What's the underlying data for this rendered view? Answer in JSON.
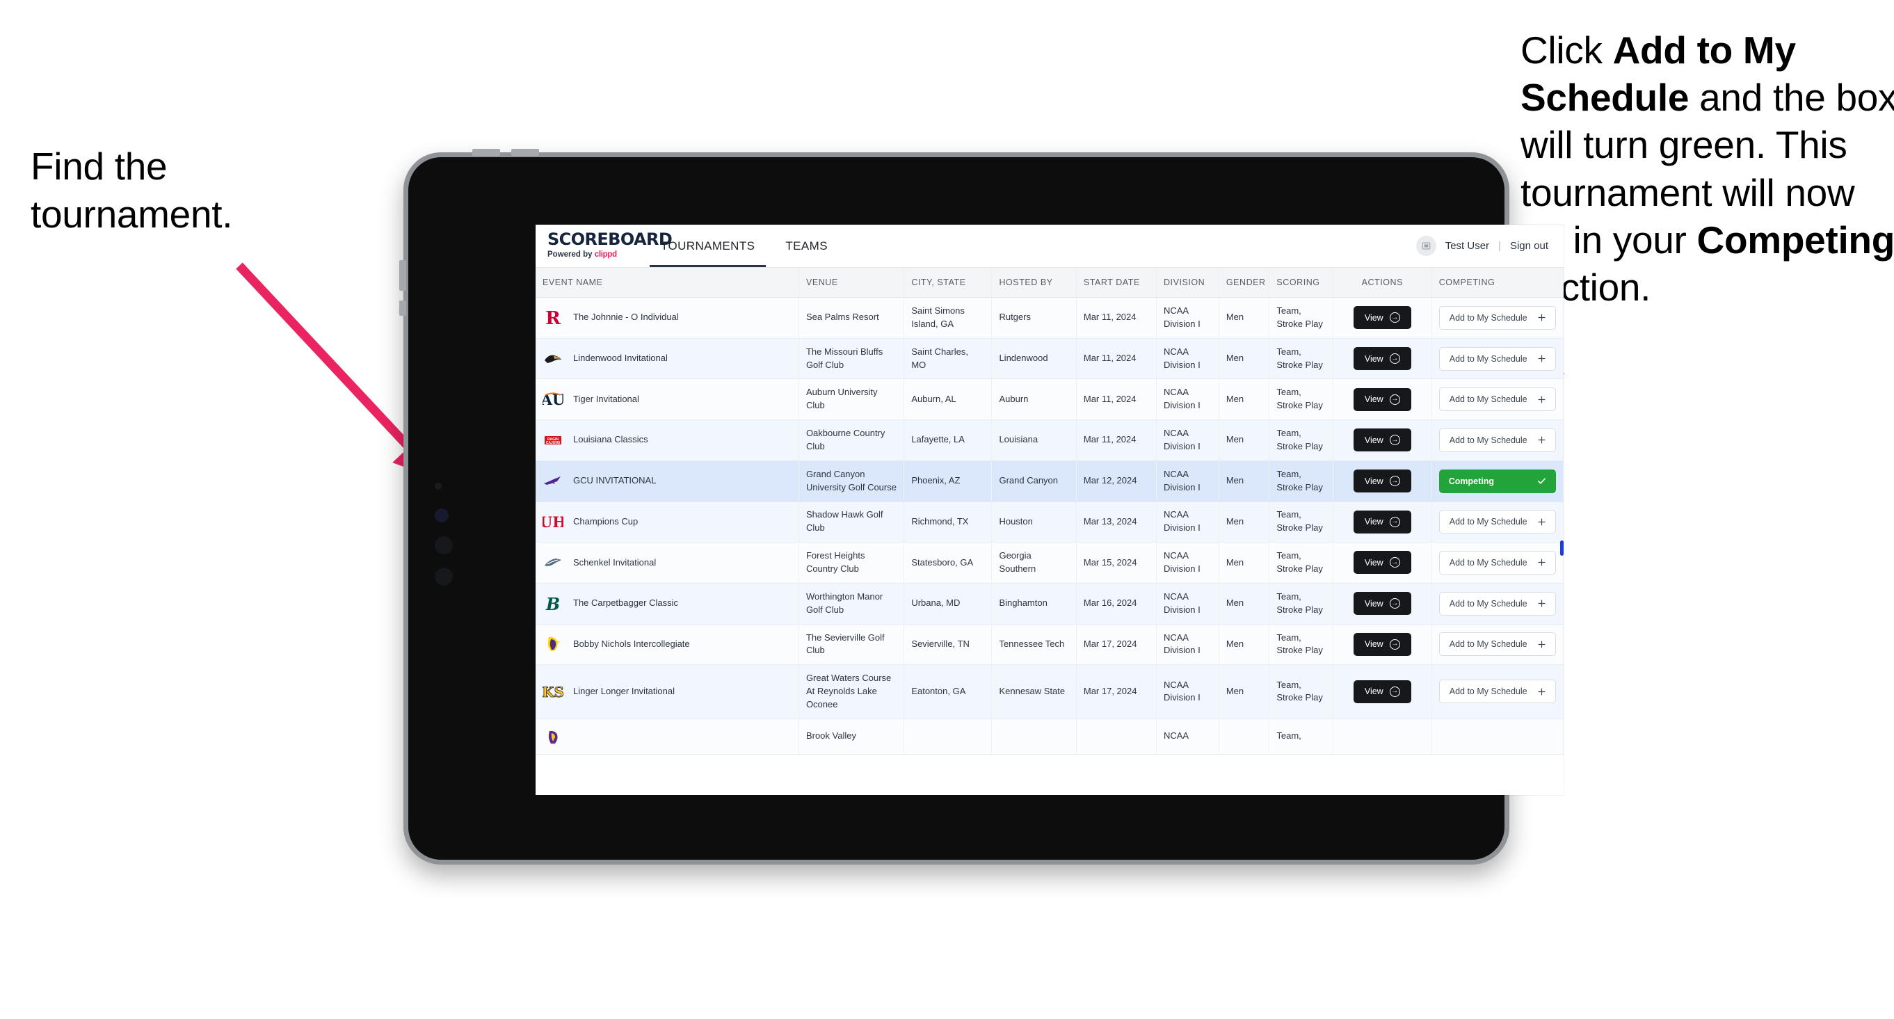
{
  "annotations": {
    "left": {
      "lines": [
        "Find the",
        "tournament."
      ]
    },
    "right": {
      "p1_pre": "Click ",
      "p1_bold": "Add to My Schedule",
      "p1_post": " and the box will turn green. This tournament will now be in your ",
      "p2_bold": "Competing",
      "p2_post": " section."
    },
    "arrow_color": "#ea2461"
  },
  "app": {
    "brand": {
      "title": "SCOREBOARD",
      "powered_prefix": "Powered by ",
      "powered_brand": "clippd"
    },
    "nav": [
      {
        "label": "TOURNAMENTS",
        "active": true
      },
      {
        "label": "TEAMS",
        "active": false
      }
    ],
    "user": {
      "avatar_icon": "user-avatar-icon",
      "name": "Test User",
      "divider": "|",
      "sign_out": "Sign out"
    }
  },
  "table": {
    "columns": [
      "EVENT NAME",
      "VENUE",
      "CITY, STATE",
      "HOSTED BY",
      "START DATE",
      "DIVISION",
      "GENDER",
      "SCORING",
      "ACTIONS",
      "COMPETING"
    ],
    "view_label": "View",
    "add_label": "Add to My Schedule",
    "add_icon": "plus-icon",
    "competing_label": "Competing",
    "competing_icon": "check-icon",
    "competing_color": "#23a43a",
    "rows": [
      {
        "logo": "rutgers-logo",
        "event": "The Johnnie - O Individual",
        "venue": "Sea Palms Resort",
        "city": "Saint Simons Island, GA",
        "host": "Rutgers",
        "date": "Mar 11, 2024",
        "division": "NCAA Division I",
        "gender": "Men",
        "scoring": "Team, Stroke Play",
        "competing": false
      },
      {
        "logo": "lindenwood-logo",
        "event": "Lindenwood Invitational",
        "venue": "The Missouri Bluffs Golf Club",
        "city": "Saint Charles, MO",
        "host": "Lindenwood",
        "date": "Mar 11, 2024",
        "division": "NCAA Division I",
        "gender": "Men",
        "scoring": "Team, Stroke Play",
        "competing": false
      },
      {
        "logo": "auburn-logo",
        "event": "Tiger Invitational",
        "venue": "Auburn University Club",
        "city": "Auburn, AL",
        "host": "Auburn",
        "date": "Mar 11, 2024",
        "division": "NCAA Division I",
        "gender": "Men",
        "scoring": "Team, Stroke Play",
        "competing": false
      },
      {
        "logo": "louisiana-logo",
        "event": "Louisiana Classics",
        "venue": "Oakbourne Country Club",
        "city": "Lafayette, LA",
        "host": "Louisiana",
        "date": "Mar 11, 2024",
        "division": "NCAA Division I",
        "gender": "Men",
        "scoring": "Team, Stroke Play",
        "competing": false
      },
      {
        "logo": "gcu-logo",
        "event": "GCU INVITATIONAL",
        "venue": "Grand Canyon University Golf Course",
        "city": "Phoenix, AZ",
        "host": "Grand Canyon",
        "date": "Mar 12, 2024",
        "division": "NCAA Division I",
        "gender": "Men",
        "scoring": "Team, Stroke Play",
        "competing": true
      },
      {
        "logo": "houston-logo",
        "event": "Champions Cup",
        "venue": "Shadow Hawk Golf Club",
        "city": "Richmond, TX",
        "host": "Houston",
        "date": "Mar 13, 2024",
        "division": "NCAA Division I",
        "gender": "Men",
        "scoring": "Team, Stroke Play",
        "competing": false
      },
      {
        "logo": "georgia-southern-logo",
        "event": "Schenkel Invitational",
        "venue": "Forest Heights Country Club",
        "city": "Statesboro, GA",
        "host": "Georgia Southern",
        "date": "Mar 15, 2024",
        "division": "NCAA Division I",
        "gender": "Men",
        "scoring": "Team, Stroke Play",
        "competing": false
      },
      {
        "logo": "binghamton-logo",
        "event": "The Carpetbagger Classic",
        "venue": "Worthington Manor Golf Club",
        "city": "Urbana, MD",
        "host": "Binghamton",
        "date": "Mar 16, 2024",
        "division": "NCAA Division I",
        "gender": "Men",
        "scoring": "Team, Stroke Play",
        "competing": false
      },
      {
        "logo": "tennessee-tech-logo",
        "event": "Bobby Nichols Intercollegiate",
        "venue": "The Sevierville Golf Club",
        "city": "Sevierville, TN",
        "host": "Tennessee Tech",
        "date": "Mar 17, 2024",
        "division": "NCAA Division I",
        "gender": "Men",
        "scoring": "Team, Stroke Play",
        "competing": false
      },
      {
        "logo": "kennesaw-state-logo",
        "event": "Linger Longer Invitational",
        "venue": "Great Waters Course At Reynolds Lake Oconee",
        "city": "Eatonton, GA",
        "host": "Kennesaw State",
        "date": "Mar 17, 2024",
        "division": "NCAA Division I",
        "gender": "Men",
        "scoring": "Team, Stroke Play",
        "competing": false
      },
      {
        "logo": "ecu-logo",
        "event": "",
        "venue": "Brook Valley",
        "city": "",
        "host": "",
        "date": "",
        "division": "NCAA",
        "gender": "",
        "scoring": "Team,",
        "competing": false
      }
    ]
  }
}
